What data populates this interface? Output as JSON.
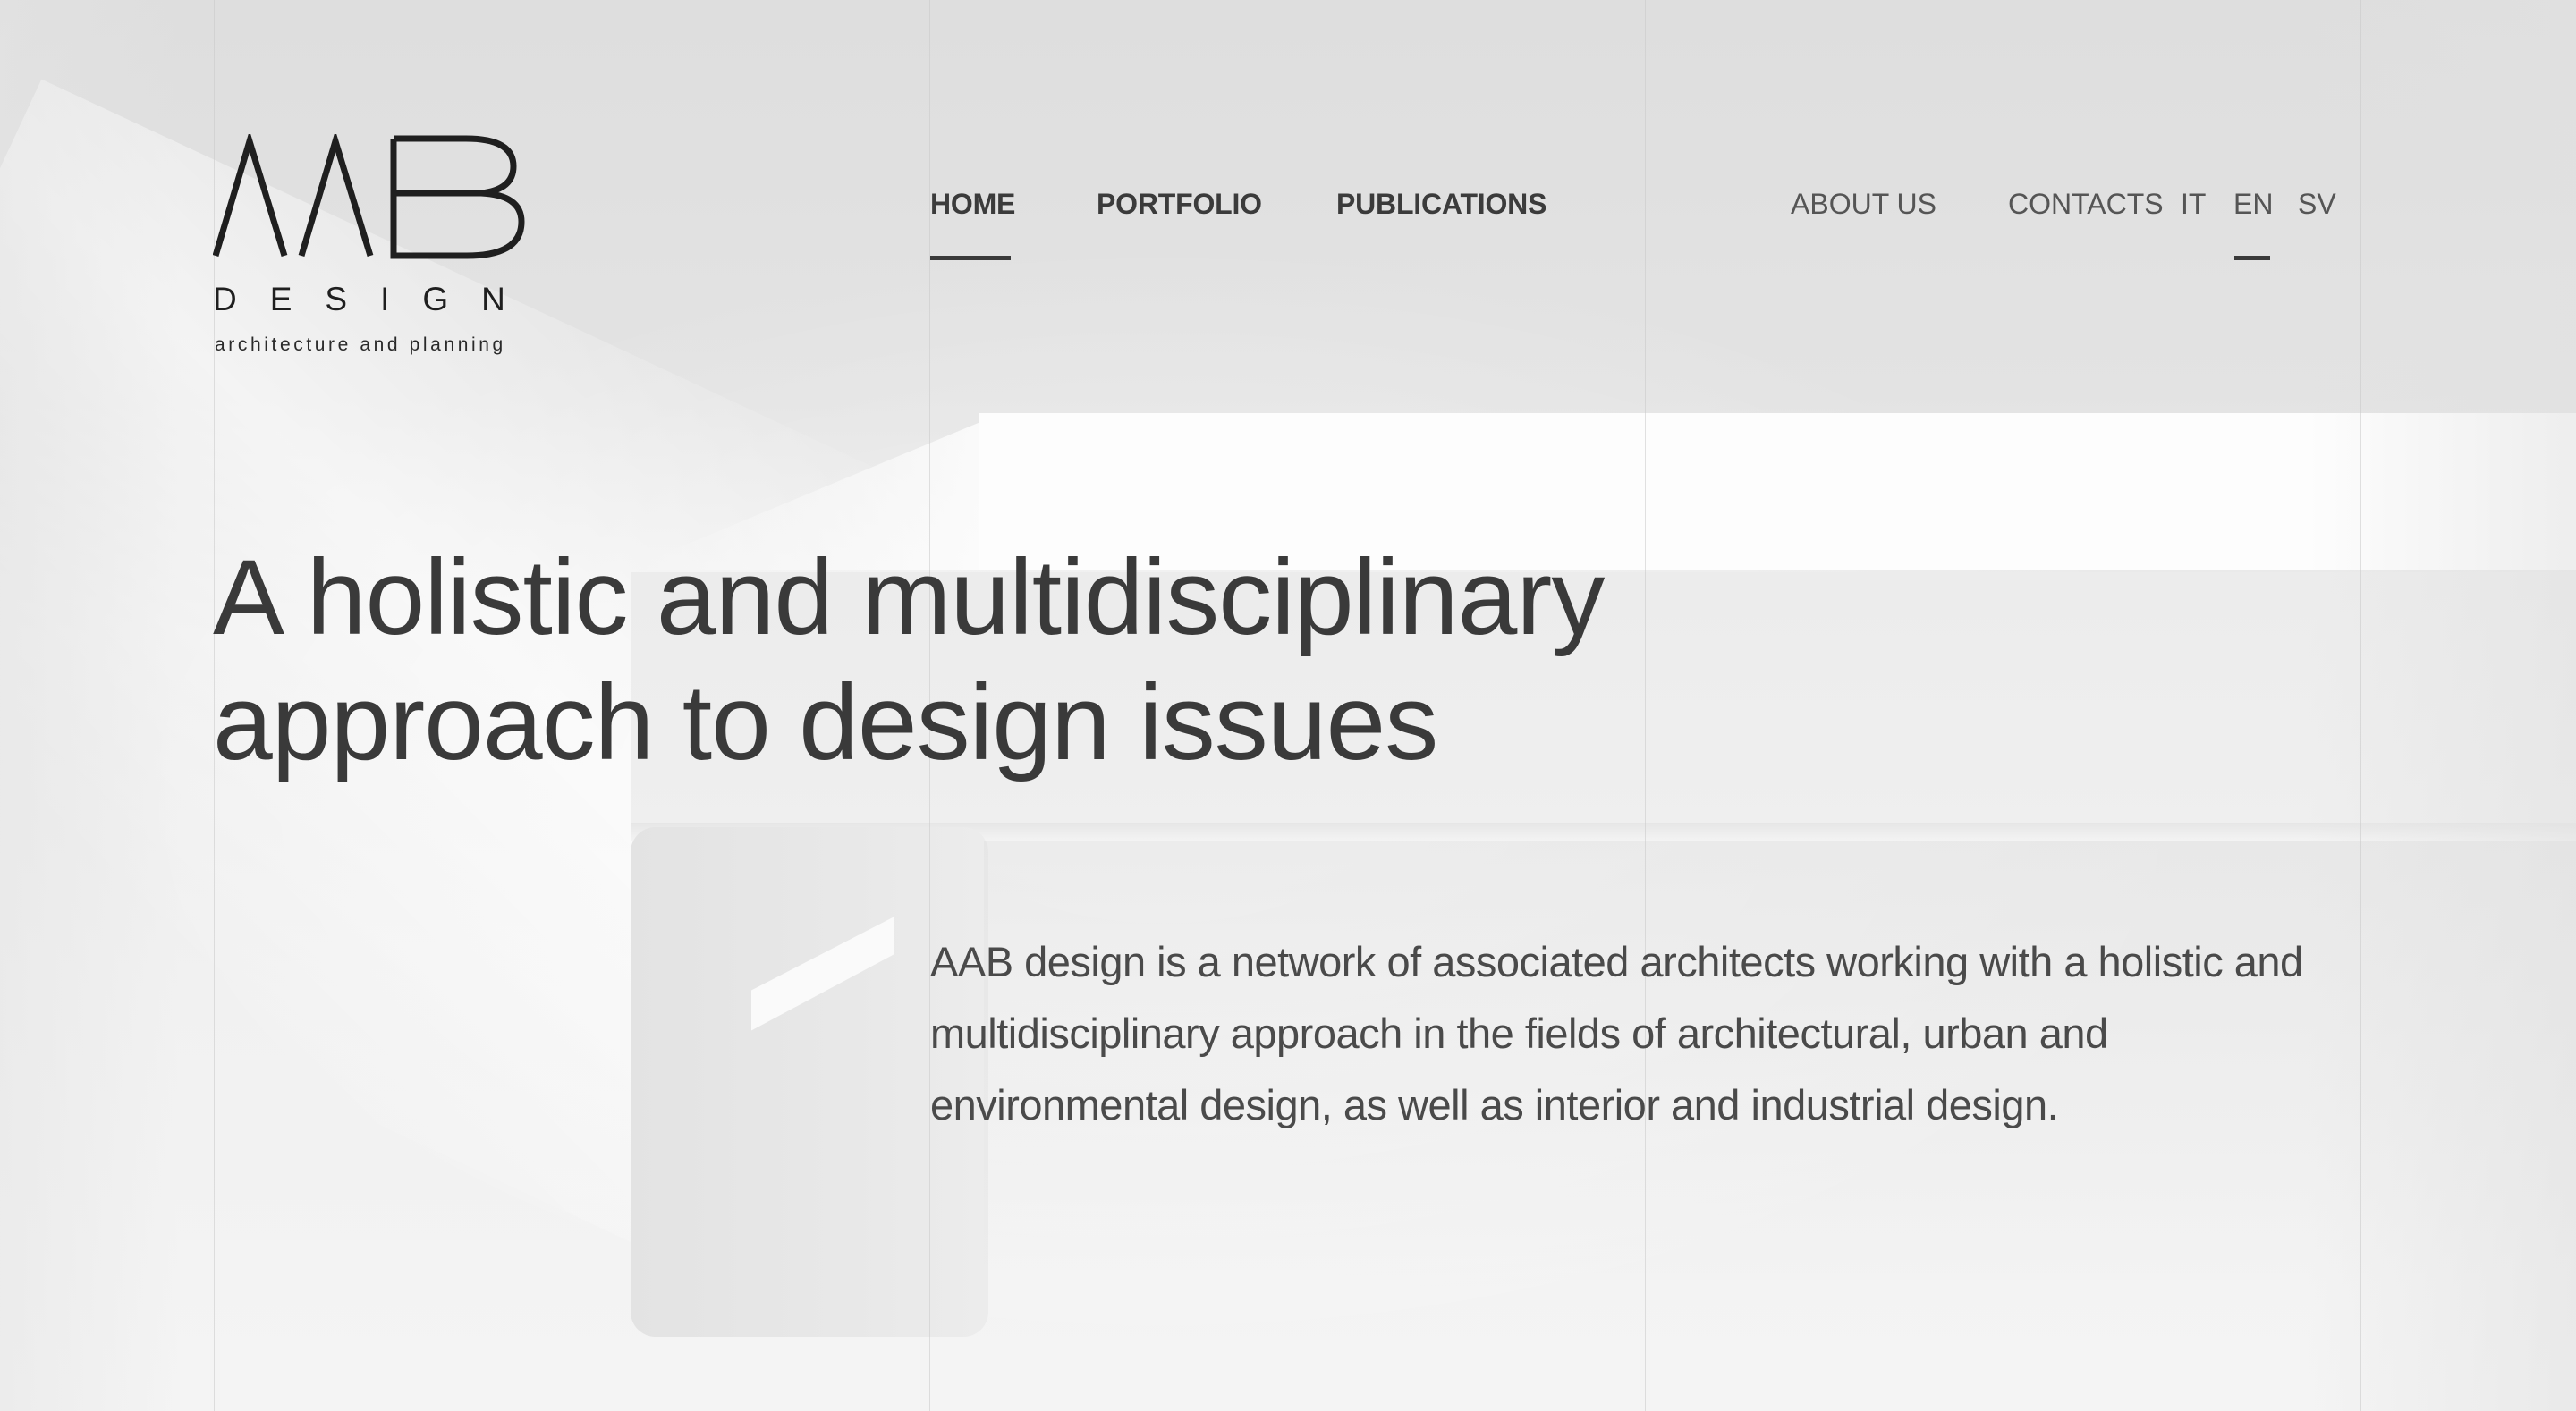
{
  "brand": {
    "logo_mark": "AAB",
    "logo_word": "DESIGN",
    "tagline": "architecture and planning"
  },
  "nav": {
    "main": [
      {
        "label": "HOME",
        "active": true
      },
      {
        "label": "PORTFOLIO",
        "active": false
      },
      {
        "label": "PUBLICATIONS",
        "active": false
      }
    ],
    "secondary": [
      {
        "label": "ABOUT US"
      },
      {
        "label": "CONTACTS"
      }
    ],
    "languages": [
      {
        "label": "IT",
        "active": false
      },
      {
        "label": "EN",
        "active": true
      },
      {
        "label": "SV",
        "active": false
      }
    ]
  },
  "hero": {
    "headline_line1": "A holistic and multidisciplinary",
    "headline_line2": "approach to design issues",
    "intro": "AAB design is a network of associated architects working with a holistic and multidisciplinary approach in the fields of architectural, urban and environmental design, as well as interior and industrial design."
  },
  "colors": {
    "text": "#3a3a3a",
    "underline": "#3a3a3a",
    "background": "#f2f2f2"
  }
}
